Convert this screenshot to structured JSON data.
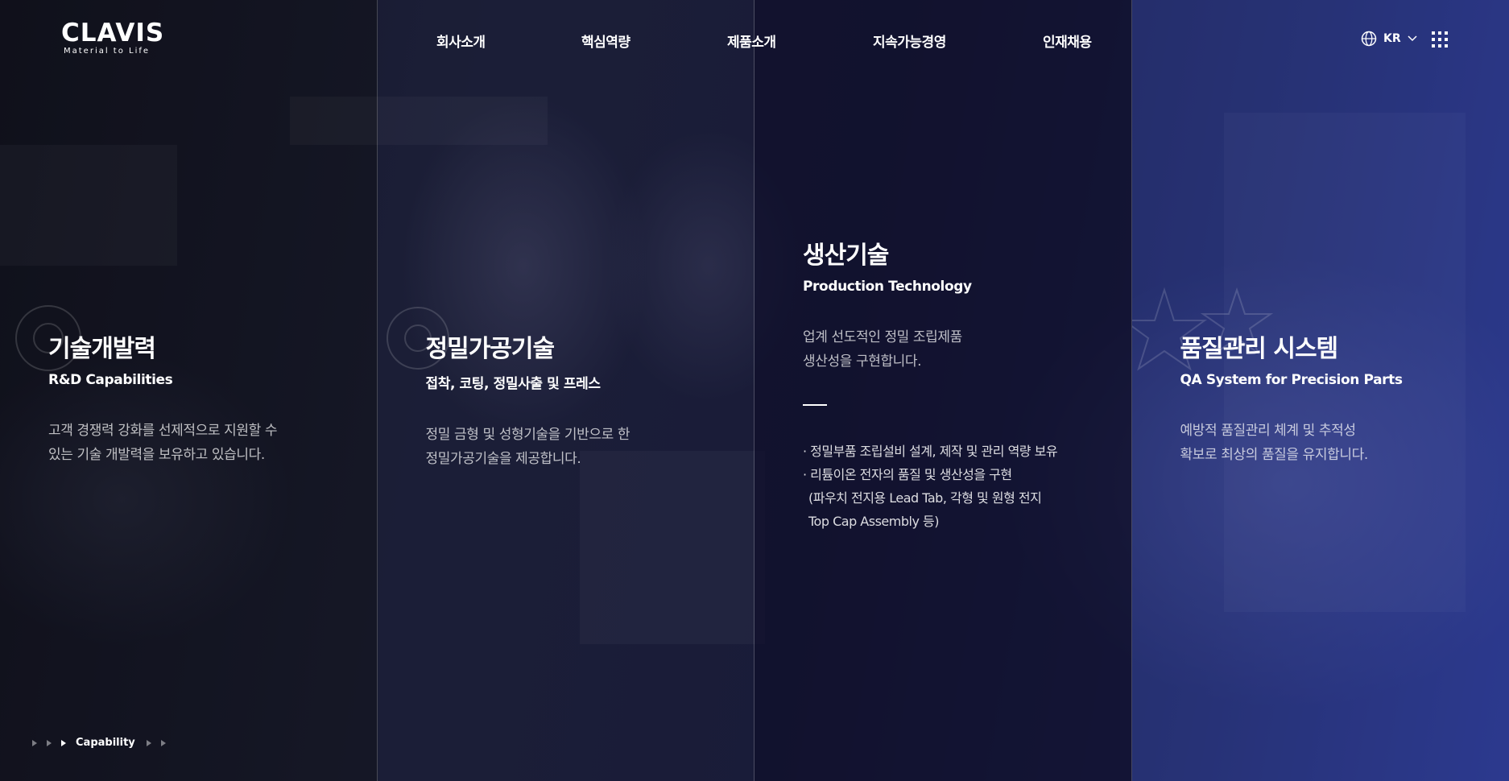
{
  "brand": {
    "logo": "CLAVIS",
    "tagline": "Material to Life"
  },
  "nav": {
    "items": [
      {
        "label": "회사소개"
      },
      {
        "label": "핵심역량"
      },
      {
        "label": "제품소개"
      },
      {
        "label": "지속가능경영"
      },
      {
        "label": "인재채용"
      }
    ]
  },
  "header": {
    "language": "KR",
    "language_icon": "globe-icon",
    "menu_icon": "grid-menu-icon"
  },
  "panels": [
    {
      "title": "기술개발력",
      "subtitle": "R&D Capabilities",
      "desc_line1": "고객 경쟁력 강화를 선제적으로 지원할 수",
      "desc_line2": "있는 기술 개발력을 보유하고 있습니다."
    },
    {
      "title": "정밀가공기술",
      "subtitle": "접착, 코팅, 정밀사출 및 프레스",
      "desc_line1": "정밀 금형 및 성형기술을 기반으로 한",
      "desc_line2": "정밀가공기술을 제공합니다."
    },
    {
      "title": "생산기술",
      "subtitle": "Production Technology",
      "desc_line1": "업계 선도적인 정밀 조립제품",
      "desc_line2": "생산성을 구현합니다.",
      "bullets": [
        "· 정밀부품 조립설비 설계, 제작 및 관리 역량 보유",
        "· 리튬이온 전자의 품질 및 생산성을 구현",
        "(파우치 전지용 Lead Tab, 각형 및 원형 전지",
        "Top Cap Assembly 등)"
      ]
    },
    {
      "title": "품질관리 시스템",
      "subtitle": "QA System for Precision Parts",
      "desc_line1": "예방적 품질관리 체계 및 추적성",
      "desc_line2": "확보로 최상의 품질을 유지합니다."
    }
  ],
  "pager": {
    "label": "Capability"
  },
  "colors": {
    "accent_panel": "#2c3888",
    "dark_panel": "#0f102d"
  }
}
